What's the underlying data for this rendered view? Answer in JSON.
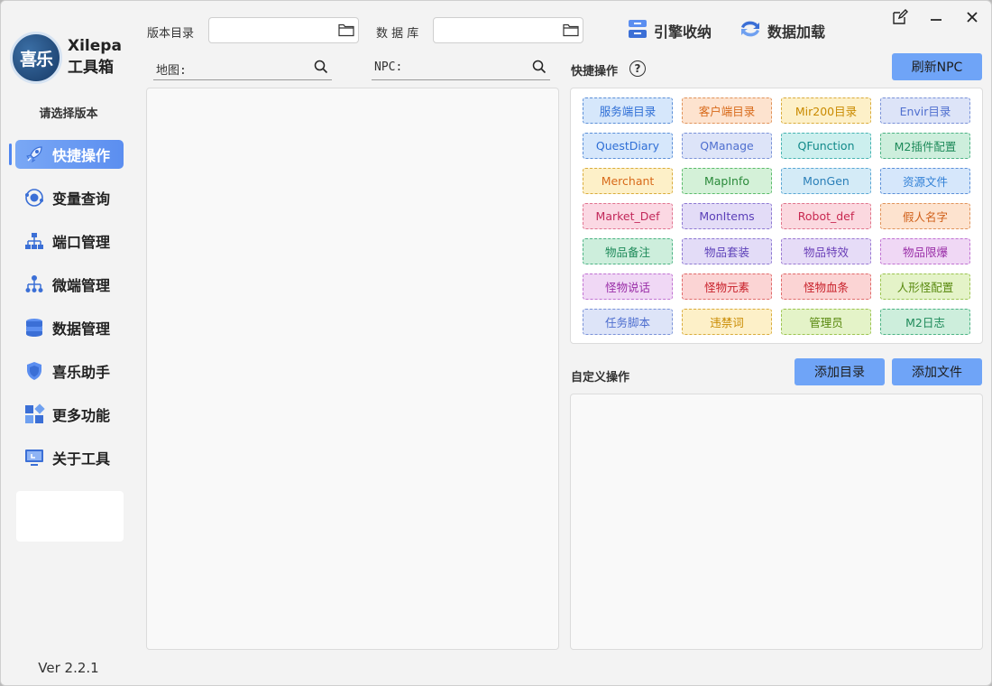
{
  "app": {
    "logo_text": "喜乐",
    "name": "Xilepa",
    "subtitle": "工具箱",
    "choose_version": "请选择版本",
    "version": "Ver 2.2.1"
  },
  "sidebar": {
    "items": [
      {
        "label": "快捷操作",
        "icon": "rocket-icon",
        "active": true
      },
      {
        "label": "变量查询",
        "icon": "atom-icon",
        "active": false
      },
      {
        "label": "端口管理",
        "icon": "network-icon",
        "active": false
      },
      {
        "label": "微端管理",
        "icon": "network-icon",
        "active": false
      },
      {
        "label": "数据管理",
        "icon": "database-icon",
        "active": false
      },
      {
        "label": "喜乐助手",
        "icon": "shield-icon",
        "active": false
      },
      {
        "label": "更多功能",
        "icon": "grid-icon",
        "active": false
      },
      {
        "label": "关于工具",
        "icon": "monitor-icon",
        "active": false
      }
    ]
  },
  "topbar": {
    "version_dir_label": "版本目录",
    "version_dir_value": "",
    "database_label": "数 据 库",
    "database_value": "",
    "engine_label": "引擎收纳",
    "data_load_label": "数据加载"
  },
  "search": {
    "map_label": "地图:",
    "map_value": "",
    "npc_label": "NPC:",
    "npc_value": ""
  },
  "quick": {
    "title": "快捷操作",
    "help": "?",
    "refresh_label": "刷新NPC",
    "buttons": [
      {
        "label": "服务端目录",
        "color": "#2f6fd6",
        "bg": "#d6e7fb",
        "border": "#5b8fd8"
      },
      {
        "label": "客户端目录",
        "color": "#d86a1a",
        "bg": "#fde3cf",
        "border": "#e0935a"
      },
      {
        "label": "Mir200目录",
        "color": "#c98a00",
        "bg": "#fdf0c8",
        "border": "#d9ac3c"
      },
      {
        "label": "Envir目录",
        "color": "#4f6fcf",
        "bg": "#dde4f8",
        "border": "#7a92d8"
      },
      {
        "label": "QuestDiary",
        "color": "#2f6fd6",
        "bg": "#d6e7fb",
        "border": "#5b8fd8"
      },
      {
        "label": "QManage",
        "color": "#4f6fcf",
        "bg": "#dde4f8",
        "border": "#7a92d8"
      },
      {
        "label": "QFunction",
        "color": "#128a8a",
        "bg": "#ccefee",
        "border": "#45b3b1"
      },
      {
        "label": "M2插件配置",
        "color": "#1e8a5a",
        "bg": "#cdeedc",
        "border": "#4cb384"
      },
      {
        "label": "Merchant",
        "color": "#d86a1a",
        "bg": "#fdf0c8",
        "border": "#d9ac3c"
      },
      {
        "label": "MapInfo",
        "color": "#2a8a3a",
        "bg": "#d4f1d8",
        "border": "#5cbb6c"
      },
      {
        "label": "MonGen",
        "color": "#2a7fb8",
        "bg": "#d4ebf7",
        "border": "#5aa7d4"
      },
      {
        "label": "资源文件",
        "color": "#2f7fd6",
        "bg": "#d6e7fb",
        "border": "#5b8fd8"
      },
      {
        "label": "Market_Def",
        "color": "#c2285a",
        "bg": "#fbd8e3",
        "border": "#e0738f"
      },
      {
        "label": "MonItems",
        "color": "#5b3fb8",
        "bg": "#e3dcf7",
        "border": "#8d78d2"
      },
      {
        "label": "Robot_def",
        "color": "#c82850",
        "bg": "#fbd8df",
        "border": "#e0738a"
      },
      {
        "label": "假人名字",
        "color": "#d0601a",
        "bg": "#fde3cf",
        "border": "#e0935a"
      },
      {
        "label": "物品备注",
        "color": "#1e8a5a",
        "bg": "#cdeedc",
        "border": "#4cb384"
      },
      {
        "label": "物品套装",
        "color": "#5b3fb8",
        "bg": "#e3dcf7",
        "border": "#8d78d2"
      },
      {
        "label": "物品特效",
        "color": "#6a3fb8",
        "bg": "#e6dcf7",
        "border": "#9a78d2"
      },
      {
        "label": "物品限爆",
        "color": "#9a2fa8",
        "bg": "#f0d8f5",
        "border": "#c072d2"
      },
      {
        "label": "怪物说话",
        "color": "#9a2fa8",
        "bg": "#f0d8f5",
        "border": "#c072d2"
      },
      {
        "label": "怪物元素",
        "color": "#c8202a",
        "bg": "#fbd4d4",
        "border": "#e06a6a"
      },
      {
        "label": "怪物血条",
        "color": "#c8202a",
        "bg": "#fbd4d4",
        "border": "#e06a6a"
      },
      {
        "label": "人形怪配置",
        "color": "#5a8a10",
        "bg": "#e4f3c8",
        "border": "#9cc450"
      },
      {
        "label": "任务脚本",
        "color": "#4f6fcf",
        "bg": "#dde4f8",
        "border": "#7a92d8"
      },
      {
        "label": "违禁词",
        "color": "#c98a00",
        "bg": "#fdf0c8",
        "border": "#d9ac3c"
      },
      {
        "label": "管理员",
        "color": "#5a8a10",
        "bg": "#e4f3c8",
        "border": "#9cc450"
      },
      {
        "label": "M2日志",
        "color": "#1e8a5a",
        "bg": "#cdeedc",
        "border": "#4cb384"
      }
    ]
  },
  "custom": {
    "title": "自定义操作",
    "add_dir_label": "添加目录",
    "add_file_label": "添加文件"
  }
}
